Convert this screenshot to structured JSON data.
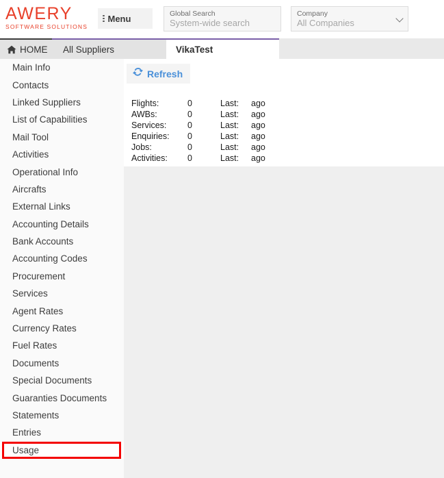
{
  "header": {
    "logo_word": "AWERY",
    "logo_sub": "SOFTWARE SOLUTIONS",
    "menu_label": "Menu",
    "global_search": {
      "label": "Global Search",
      "placeholder": "System-wide search",
      "value": ""
    },
    "company": {
      "label": "Company",
      "value": "All Companies"
    }
  },
  "tabs": [
    {
      "label": "HOME",
      "icon": "home-icon",
      "active": false
    },
    {
      "label": "All Suppliers",
      "active": false
    },
    {
      "label": "VikaTest",
      "active": true
    }
  ],
  "sidebar": {
    "items": [
      {
        "label": "Main Info"
      },
      {
        "label": "Contacts"
      },
      {
        "label": "Linked Suppliers"
      },
      {
        "label": "List of Capabilities"
      },
      {
        "label": "Mail Tool"
      },
      {
        "label": "Activities"
      },
      {
        "label": "Operational Info"
      },
      {
        "label": "Aircrafts"
      },
      {
        "label": "External Links"
      },
      {
        "label": "Accounting Details"
      },
      {
        "label": "Bank Accounts"
      },
      {
        "label": "Accounting Codes"
      },
      {
        "label": "Procurement"
      },
      {
        "label": "Services"
      },
      {
        "label": "Agent Rates"
      },
      {
        "label": "Currency Rates"
      },
      {
        "label": "Fuel Rates"
      },
      {
        "label": "Documents"
      },
      {
        "label": "Special Documents"
      },
      {
        "label": "Guaranties Documents"
      },
      {
        "label": "Statements"
      },
      {
        "label": "Entries"
      },
      {
        "label": "Usage"
      }
    ],
    "highlighted_item": "Usage",
    "highlight_color": "#f40000"
  },
  "main": {
    "refresh_label": "Refresh",
    "refresh_icon": "refresh-icon",
    "stats": [
      {
        "name": "Flights:",
        "value": "0",
        "last_label": "Last:",
        "ago": "ago"
      },
      {
        "name": "AWBs:",
        "value": "0",
        "last_label": "Last:",
        "ago": "ago"
      },
      {
        "name": "Services:",
        "value": "0",
        "last_label": "Last:",
        "ago": "ago"
      },
      {
        "name": "Enquiries:",
        "value": "0",
        "last_label": "Last:",
        "ago": "ago"
      },
      {
        "name": "Jobs:",
        "value": "0",
        "last_label": "Last:",
        "ago": "ago"
      },
      {
        "name": "Activities:",
        "value": "0",
        "last_label": "Last:",
        "ago": "ago"
      }
    ]
  },
  "colors": {
    "brand": "#e8402a",
    "accent_link": "#4a90d9",
    "tab_accent": "#7a5fa8",
    "highlight": "#f40000"
  }
}
